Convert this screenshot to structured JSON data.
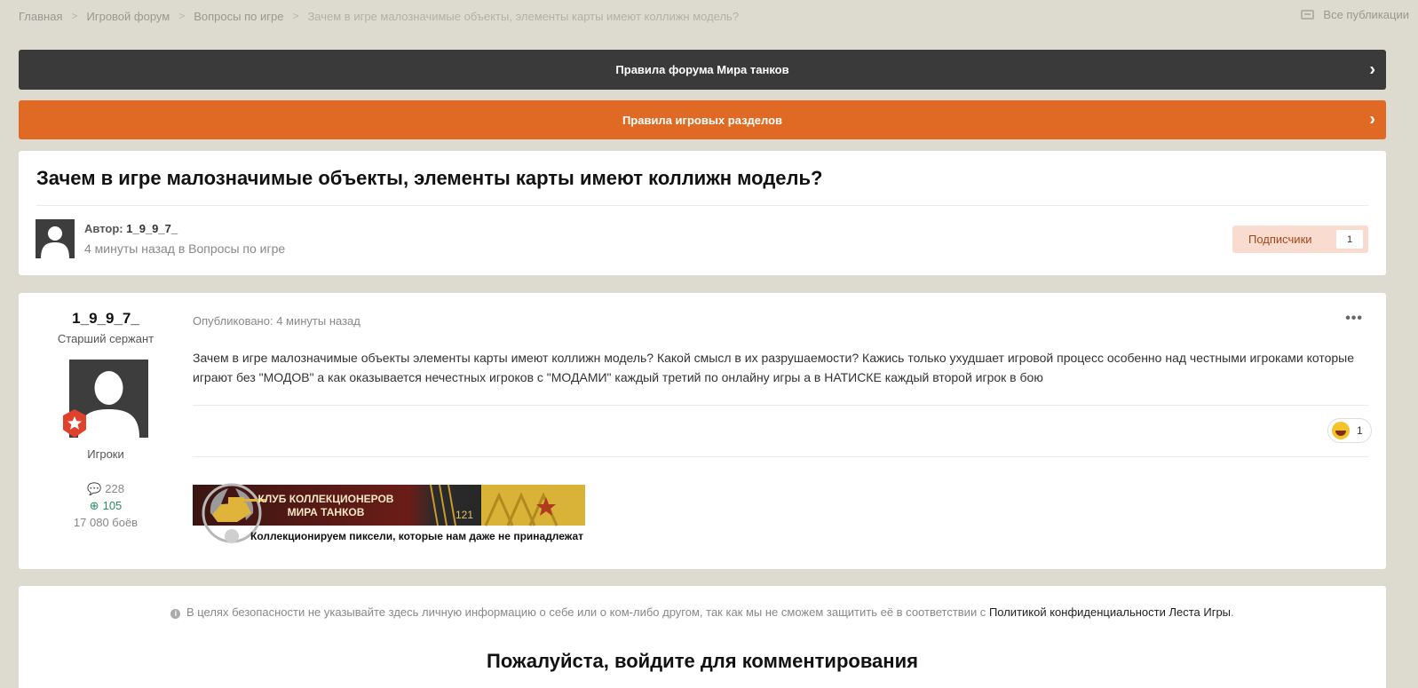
{
  "breadcrumb": {
    "items": [
      "Главная",
      "Игровой форум",
      "Вопросы по игре"
    ],
    "current": "Зачем в игре малозначимые объекты, элементы карты имеют коллижн модель?",
    "all_publications": "Все публикации"
  },
  "banners": {
    "forum_rules": "Правила форума Мира танков",
    "game_rules": "Правила игровых разделов"
  },
  "topic": {
    "title": "Зачем в игре малозначимые объекты, элементы карты имеют коллижн модель?",
    "author_prefix": "Автор:",
    "author": "1_9_9_7_",
    "meta": "4 минуты назад в Вопросы по игре",
    "subscribers_label": "Подписчики",
    "subscribers_count": "1"
  },
  "post": {
    "username": "1_9_9_7_",
    "rank": "Старший сержант",
    "group": "Игроки",
    "posts_count": "228",
    "reputation": "105",
    "battles": "17 080 боёв",
    "published": "Опубликовано: 4 минуты назад",
    "menu": "•••",
    "body": "Зачем в игре малозначимые объекты элементы карты имеют коллижн модель? Какой смысл в их разрушаемости? Кажись только ухудшает игровой процесс особенно над честными игроками которые играют без \"МОДОВ\" а как оказывается нечестных игроков с \"МОДАМИ\" каждый третий по онлайну игры а в НАТИСКЕ каждый второй игрок в бою",
    "reaction_count": "1",
    "signature": {
      "line1": "КЛУБ КОЛЛЕКЦИОНЕРОВ",
      "line2": "МИРА ТАНКОВ",
      "number": "121",
      "tagline": "Коллекционируем пиксели, которые нам даже не принадлежат"
    }
  },
  "footer": {
    "privacy_text": "В целях безопасности не указывайте здесь личную информацию о себе или о ком-либо другом, так как мы не сможем защитить её в соответствии с",
    "privacy_link": "Политикой конфиденциальности Леста Игры",
    "login_title": "Пожалуйста, войдите для комментирования"
  },
  "colors": {
    "background": "#dddbcf",
    "dark_banner": "#3a3a3a",
    "orange_banner": "#e06a23",
    "subscribe_bg": "#f9dccf",
    "reputation": "#2e8a5f"
  }
}
